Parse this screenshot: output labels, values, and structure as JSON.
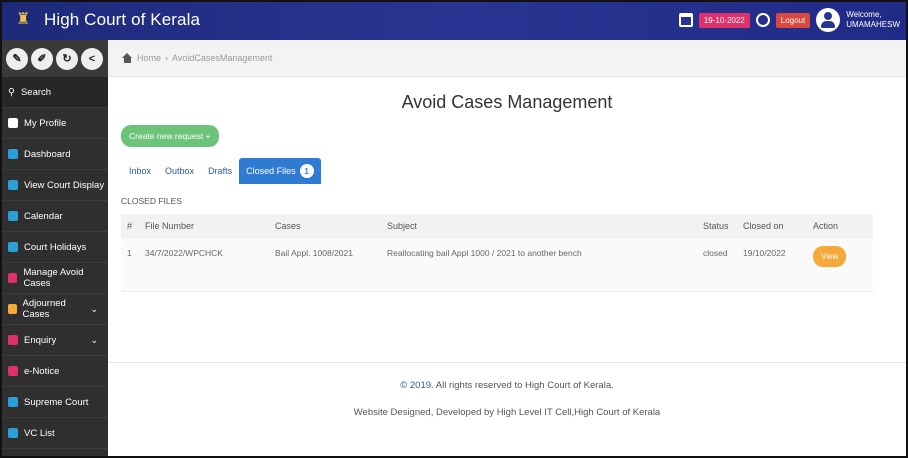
{
  "header": {
    "title": "High Court of Kerala",
    "date": "19-10-2022",
    "logout_label": "Logout",
    "welcome_line1": "Welcome,",
    "welcome_line2": "UMAMAHESW"
  },
  "sidebar": {
    "tool_icons": [
      "edit-icon",
      "pencil-icon",
      "refresh-icon",
      "share-icon"
    ],
    "search_label": "Search",
    "items": [
      {
        "label": "My Profile",
        "icon": "user-icon",
        "icon_color": "#ffffff"
      },
      {
        "label": "Dashboard",
        "icon": "dashboard-icon",
        "icon_color": "#2aa0d6"
      },
      {
        "label": "View Court Display",
        "icon": "display-icon",
        "icon_color": "#2aa0d6"
      },
      {
        "label": "Calendar",
        "icon": "calendar-icon",
        "icon_color": "#2aa0d6"
      },
      {
        "label": "Court Holidays",
        "icon": "holiday-icon",
        "icon_color": "#2aa0d6"
      },
      {
        "label": "Manage Avoid Cases",
        "icon": "cases-icon",
        "icon_color": "#e0306c"
      },
      {
        "label": "Adjourned Cases",
        "icon": "adjourned-icon",
        "icon_color": "#f4a93a",
        "has_caret": true
      },
      {
        "label": "Enquiry",
        "icon": "enquiry-icon",
        "icon_color": "#e0306c",
        "has_caret": true
      },
      {
        "label": "e-Notice",
        "icon": "search-icon",
        "icon_color": "#e0306c"
      },
      {
        "label": "Supreme Court",
        "icon": "search-icon",
        "icon_color": "#2aa0d6"
      },
      {
        "label": "VC List",
        "icon": "search-icon",
        "icon_color": "#2aa0d6"
      }
    ]
  },
  "breadcrumb": {
    "home": "Home",
    "separator": "›",
    "current": "AvoidCasesManagement"
  },
  "page": {
    "title": "Avoid Cases Management",
    "new_request_label": "Create new request +",
    "tabs": [
      {
        "label": "Inbox",
        "active": false
      },
      {
        "label": "Outbox",
        "active": false
      },
      {
        "label": "Drafts",
        "active": false
      },
      {
        "label": "Closed Files",
        "active": true,
        "count": "1"
      }
    ],
    "section_label": "CLOSED FILES"
  },
  "table": {
    "headers": [
      "#",
      "File Number",
      "Cases",
      "Subject",
      "Status",
      "Closed on",
      "Action"
    ],
    "rows": [
      {
        "index": "1",
        "file_number": "34/7/2022/WPCHCK",
        "cases": "Bail Appl. 1008/2021",
        "subject": "Reallocating bail Appl 1000 / 2021 to another bench",
        "status": "closed",
        "closed_on": "19/10/2022",
        "action_label": "View"
      }
    ]
  },
  "footer": {
    "copyright_year": "© 2019.",
    "copyright_text": "All rights reserved to High Court of Kerala.",
    "credit": "Website Designed, Developed by High Level IT Cell,High Court of Kerala"
  },
  "colors": {
    "topbar": "#2a3593",
    "sidebar": "#2f2f2f",
    "accent_green": "#6cc47a",
    "accent_blue": "#2e7bd1",
    "accent_orange": "#f4a93a"
  }
}
